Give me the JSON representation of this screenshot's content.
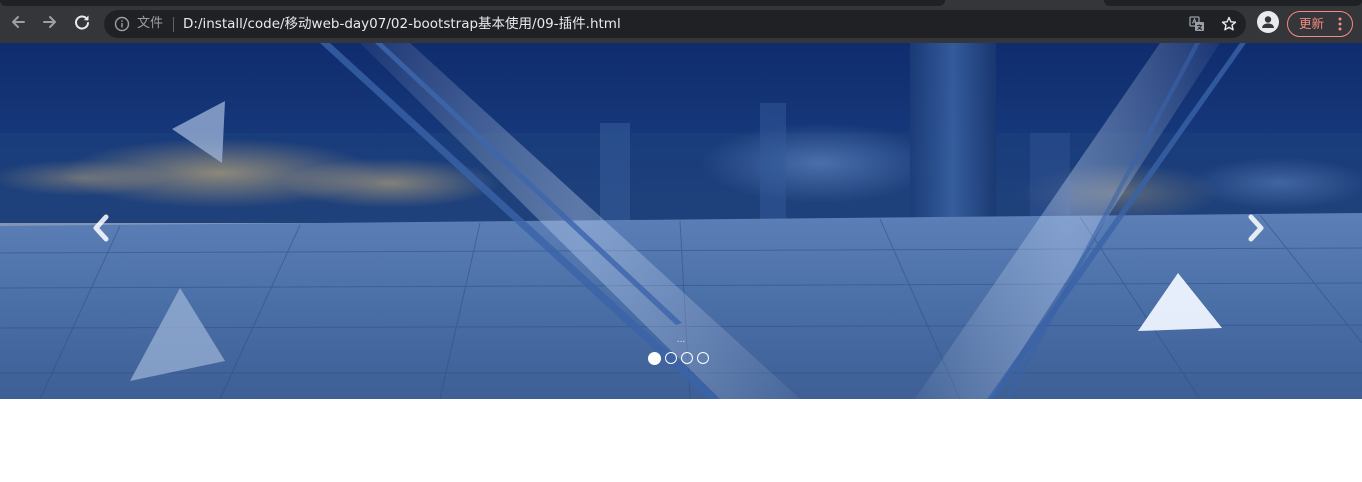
{
  "browser": {
    "security_label": "文件",
    "url": "D:/install/code/移动web-day07/02-bootstrap基本使用/09-插件.html",
    "update_label": "更新",
    "icons": {
      "back": "arrow-left-icon",
      "forward": "arrow-right-icon",
      "reload": "reload-icon",
      "info": "info-icon",
      "translate": "translate-icon",
      "bookmark": "star-icon",
      "profile": "person-icon",
      "menu": "kebab-menu-icon"
    },
    "colors": {
      "toolbar": "#35363a",
      "omnibox": "#202124",
      "update_accent": "#f28b82"
    }
  },
  "carousel": {
    "caption": "...",
    "slide_count": 4,
    "active_index": 0,
    "icons": {
      "prev": "chevron-left-icon",
      "next": "chevron-right-icon"
    }
  }
}
